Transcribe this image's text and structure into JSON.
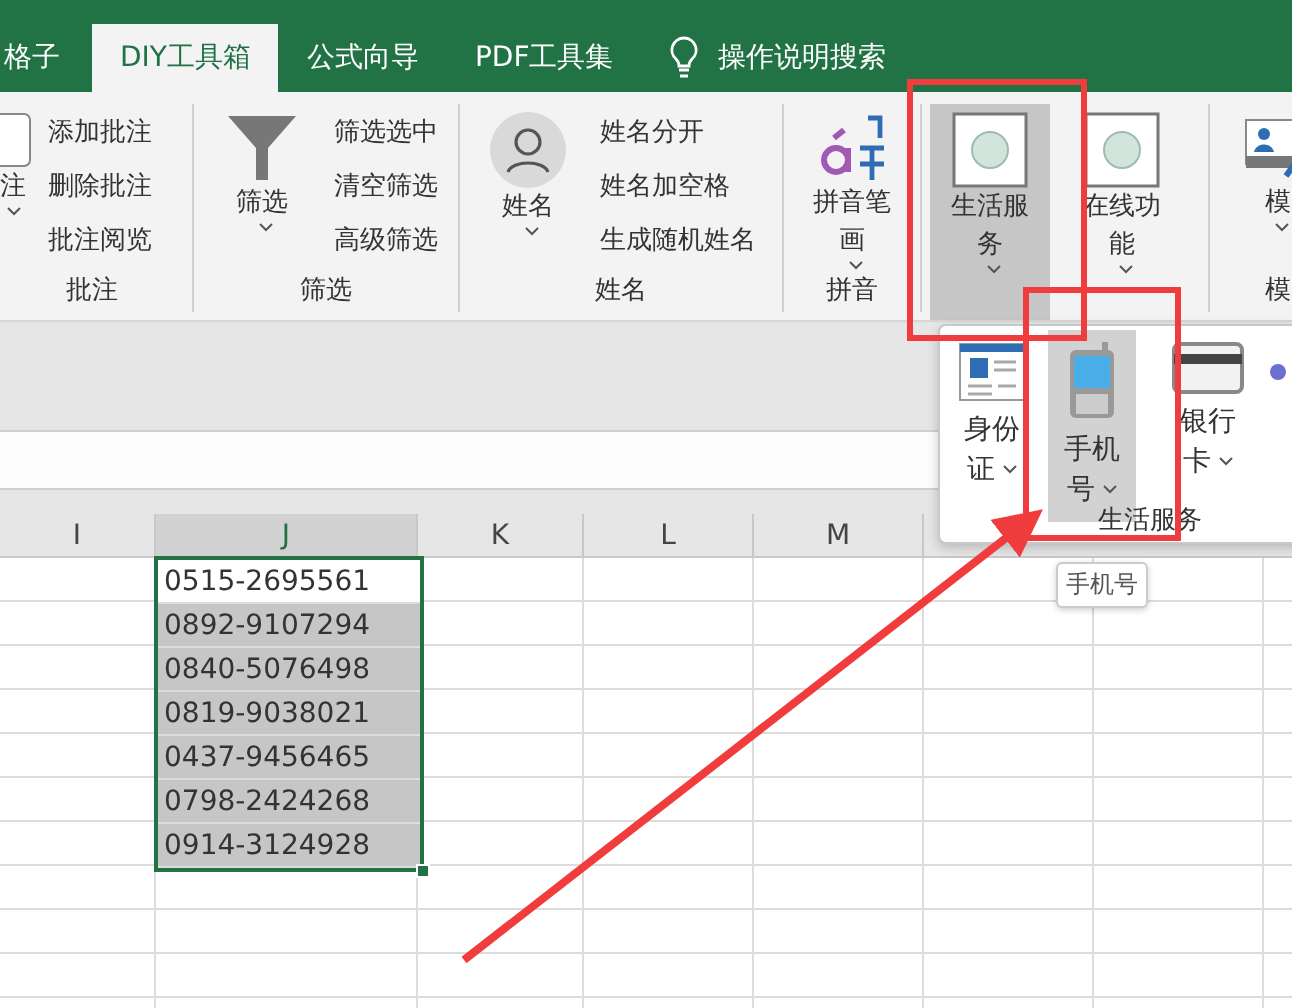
{
  "tabs": [
    {
      "label": "格子",
      "selected": false
    },
    {
      "label": "DIY工具箱",
      "selected": true
    },
    {
      "label": "公式向导",
      "selected": false
    },
    {
      "label": "PDF工具集",
      "selected": false
    }
  ],
  "search": {
    "label": "操作说明搜索"
  },
  "ribbon_groups": [
    {
      "label": "批注",
      "buttons": [
        {
          "label": "注",
          "pressed": false
        }
      ],
      "items": [
        "添加批注",
        "删除批注",
        "批注阅览"
      ]
    },
    {
      "label": "筛选",
      "buttons": [
        {
          "label": "筛选",
          "pressed": false
        }
      ],
      "items": [
        "筛选选中",
        "清空筛选",
        "高级筛选"
      ]
    },
    {
      "label": "姓名",
      "buttons": [
        {
          "label": "姓名",
          "pressed": false
        }
      ],
      "items": [
        "姓名分开",
        "姓名加空格",
        "生成随机姓名"
      ]
    },
    {
      "label": "拼音",
      "buttons": [
        {
          "label": "拼音笔画",
          "pressed": false
        }
      ]
    },
    {
      "buttons": [
        {
          "label": "生活服务",
          "pressed": true
        },
        {
          "label": "在线功能",
          "pressed": false
        }
      ]
    },
    {
      "label": "模",
      "buttons": [
        {
          "label": "模",
          "pressed": false
        }
      ]
    }
  ],
  "dropdown": {
    "title": "生活服务",
    "buttons": [
      {
        "label": "身份证",
        "selected": false
      },
      {
        "label": "手机号",
        "selected": true
      },
      {
        "label": "银行卡",
        "selected": false
      },
      {
        "selected": false
      }
    ]
  },
  "tooltip": "手机号",
  "sheet": {
    "columns": [
      {
        "label": "I",
        "selected": false
      },
      {
        "label": "J",
        "selected": true
      },
      {
        "label": "K",
        "selected": false
      },
      {
        "label": "L",
        "selected": false
      },
      {
        "label": "M",
        "selected": false
      }
    ],
    "cells": [
      {
        "value": "0515-2695561",
        "selected": false
      },
      {
        "value": "0892-9107294",
        "selected": true
      },
      {
        "value": "0840-5076498",
        "selected": true
      },
      {
        "value": "0819-9038021",
        "selected": true
      },
      {
        "value": "0437-9456465",
        "selected": true
      },
      {
        "value": "0798-2424268",
        "selected": true
      },
      {
        "value": "0914-3124928",
        "selected": true
      }
    ]
  },
  "annotations": [
    {
      "kind": "box"
    },
    {
      "kind": "box"
    },
    {
      "kind": "arrow"
    }
  ]
}
